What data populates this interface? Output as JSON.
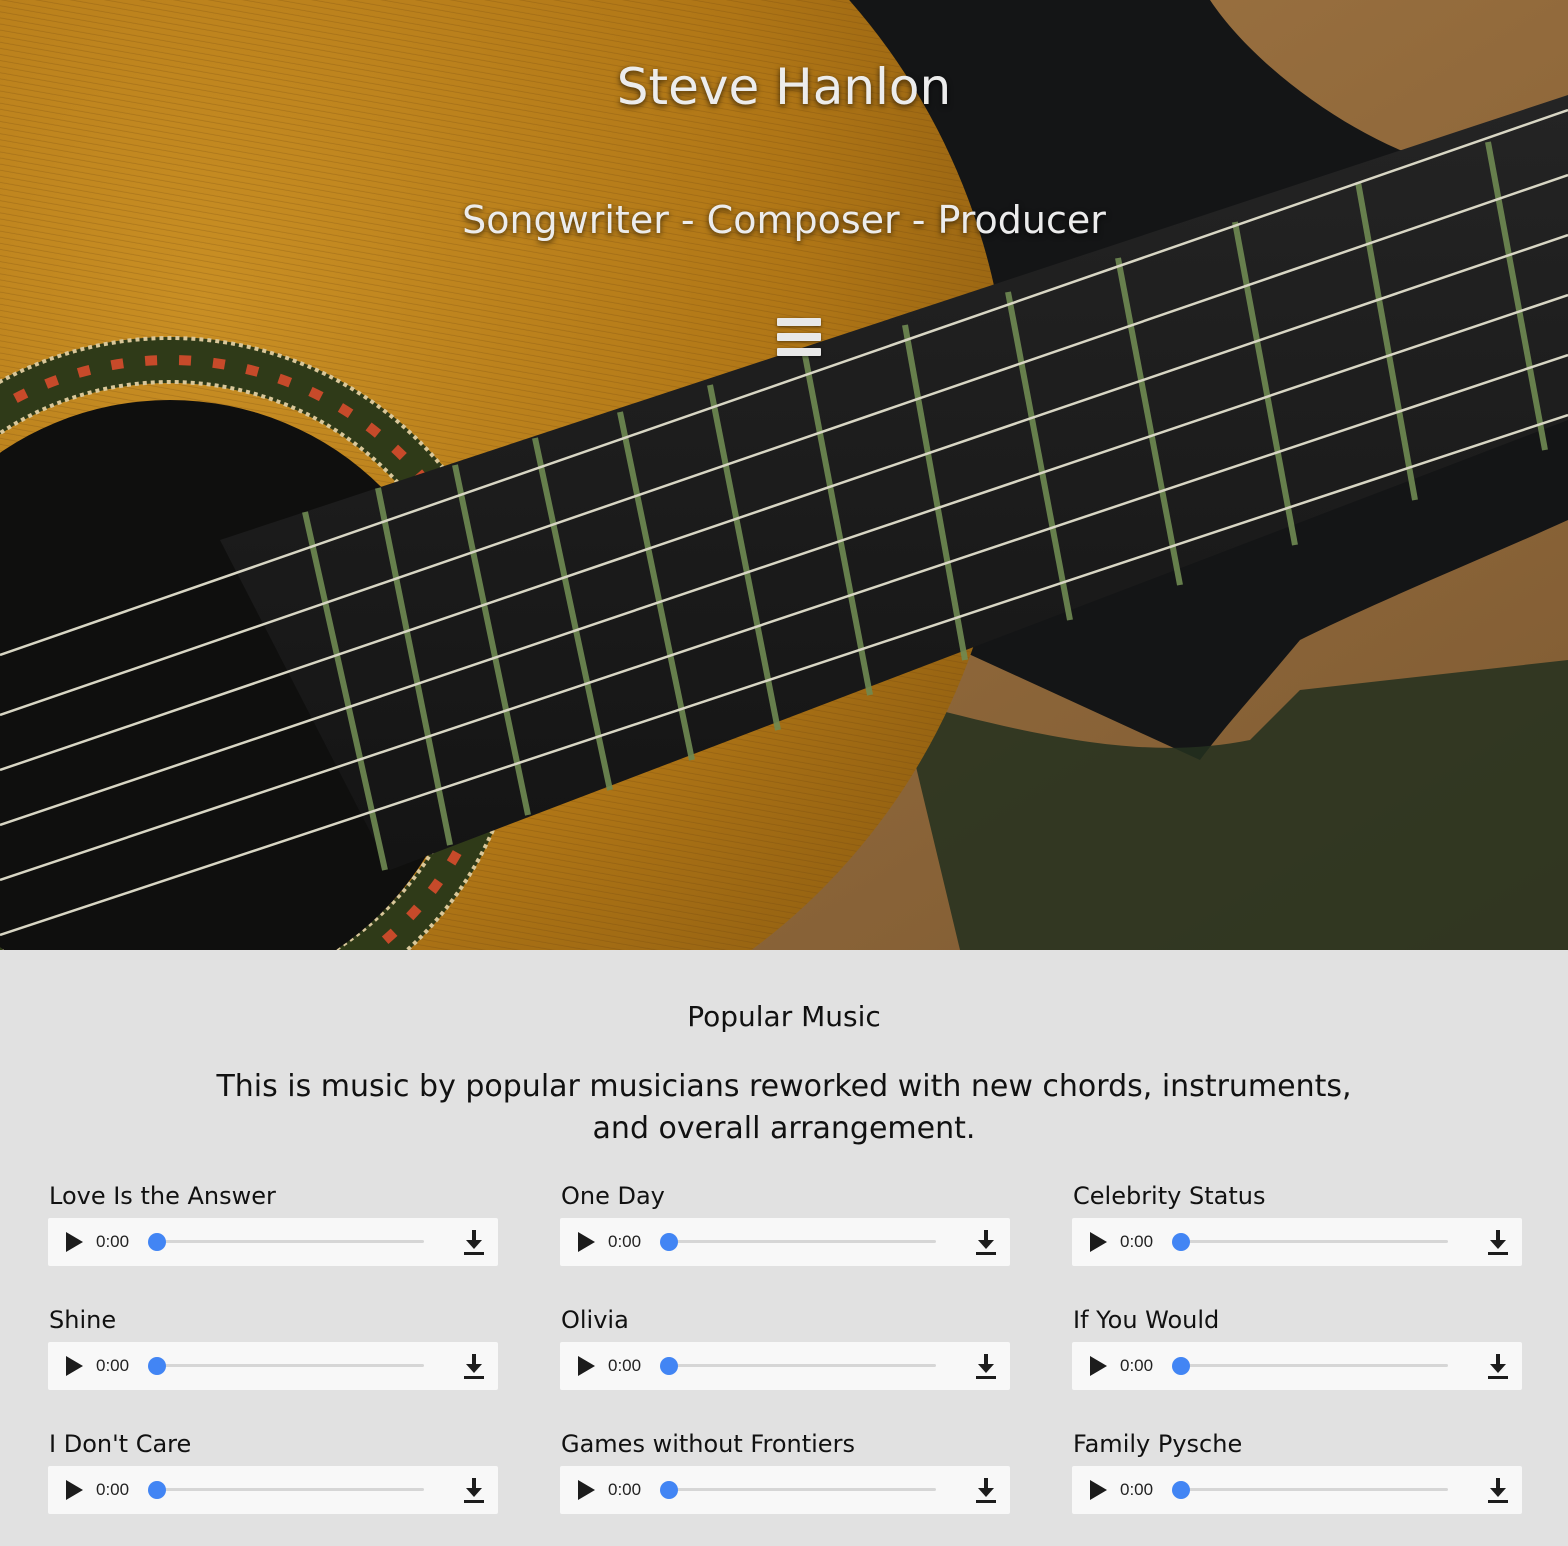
{
  "hero": {
    "title": "Steve Hanlon",
    "subtitle": "Songwriter - Composer - Producer",
    "menu_icon": "hamburger-menu-icon"
  },
  "section": {
    "title": "Popular Music",
    "description": "This is music by popular musicians reworked with new chords, instruments, and overall arrangement."
  },
  "tracks": [
    {
      "title": "Love Is the Answer",
      "time": "0:00",
      "progress": 0
    },
    {
      "title": "One Day",
      "time": "0:00",
      "progress": 0
    },
    {
      "title": "Celebrity Status",
      "time": "0:00",
      "progress": 0
    },
    {
      "title": "Shine",
      "time": "0:00",
      "progress": 0
    },
    {
      "title": "Olivia",
      "time": "0:00",
      "progress": 0
    },
    {
      "title": "If You Would",
      "time": "0:00",
      "progress": 0
    },
    {
      "title": "I Don't Care",
      "time": "0:00",
      "progress": 0
    },
    {
      "title": "Games without Frontiers",
      "time": "0:00",
      "progress": 0
    },
    {
      "title": "Family Pysche",
      "time": "0:00",
      "progress": 0
    }
  ],
  "colors": {
    "page_bg": "#e1e1e1",
    "player_bg": "#f8f8f8",
    "seek_thumb": "#4285f4"
  }
}
